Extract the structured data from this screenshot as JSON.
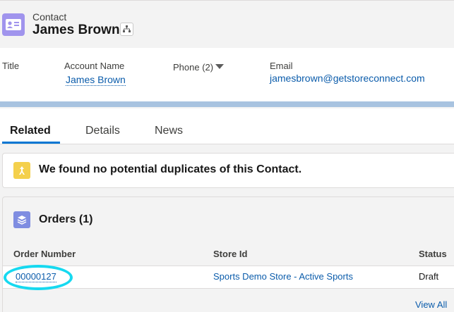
{
  "header": {
    "object_type": "Contact",
    "record_name": "James Brown"
  },
  "highlights": {
    "title_label": "Title",
    "account_label": "Account Name",
    "account_value": "James Brown",
    "phone_label": "Phone (2)",
    "email_label": "Email",
    "email_value": "jamesbrown@getstoreconnect.com"
  },
  "tabs": [
    {
      "label": "Related",
      "active": true
    },
    {
      "label": "Details",
      "active": false
    },
    {
      "label": "News",
      "active": false
    }
  ],
  "duplicates": {
    "message": "We found no potential duplicates of this Contact."
  },
  "orders": {
    "title": "Orders (1)",
    "columns": [
      "Order Number",
      "Store Id",
      "Status"
    ],
    "rows": [
      {
        "order_number": "00000127",
        "store_id": "Sports Demo Store - Active Sports",
        "status": "Draft"
      }
    ],
    "view_all": "View All"
  },
  "colors": {
    "contact_icon": "#a094ed",
    "orders_icon": "#7f8de1",
    "duplicates_icon": "#f4d04c",
    "link": "#0b5cab",
    "tab_active": "#0176d3",
    "highlight_ring": "#16d9f0"
  },
  "icons": {
    "contact": "contact-card-icon",
    "hierarchy": "hierarchy-icon",
    "duplicates": "merge-icon",
    "orders": "layers-icon",
    "phone_menu": "caret-down-icon"
  }
}
